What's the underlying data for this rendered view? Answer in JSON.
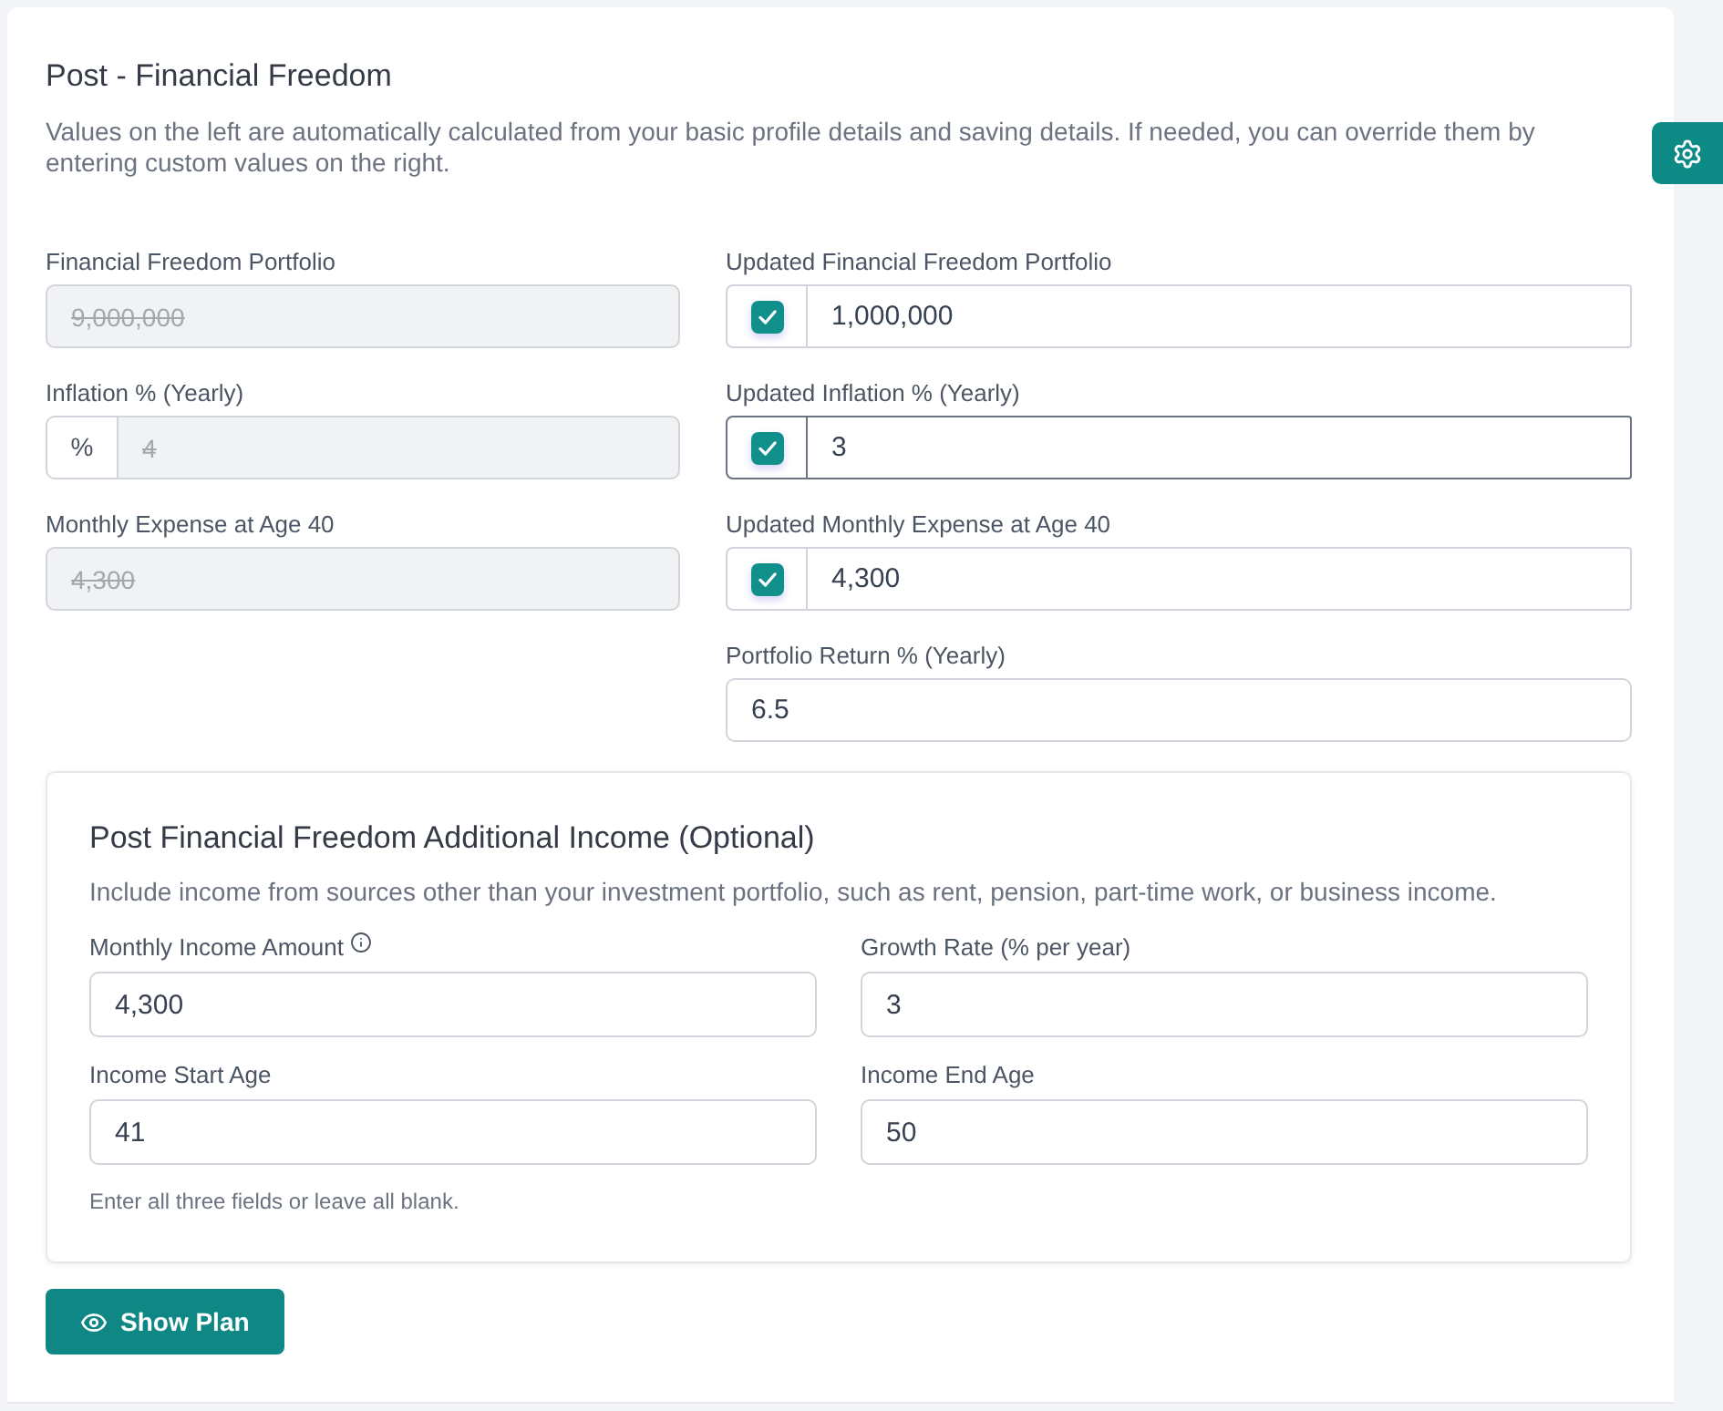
{
  "section": {
    "title": "Post - Financial Freedom",
    "description": "Values on the left are automatically calculated from your basic profile details and saving details. If needed, you can override them by entering custom values on the right."
  },
  "rows": [
    {
      "calculated": {
        "label": "Financial Freedom Portfolio",
        "value": "9,000,000",
        "disabled": true
      },
      "override": {
        "label": "Updated Financial Freedom Portfolio",
        "value": "1,000,000",
        "checked": true,
        "focused": false
      }
    },
    {
      "calculated": {
        "label": "Inflation % (Yearly)",
        "prefix": "%",
        "value": "4",
        "disabled": true
      },
      "override": {
        "label": "Updated Inflation % (Yearly)",
        "value": "3",
        "checked": true,
        "focused": true
      }
    },
    {
      "calculated": {
        "label": "Monthly Expense at Age 40",
        "value": "4,300",
        "disabled": true
      },
      "override": {
        "label": "Updated Monthly Expense at Age 40",
        "value": "4,300",
        "checked": true,
        "focused": false
      }
    }
  ],
  "portfolio_return": {
    "label": "Portfolio Return % (Yearly)",
    "value": "6.5"
  },
  "additional_income": {
    "title": "Post Financial Freedom Additional Income (Optional)",
    "description": "Include income from sources other than your investment portfolio, such as rent, pension, part-time work, or business income.",
    "fields": [
      {
        "label": "Monthly Income Amount",
        "info": true,
        "value": "4,300"
      },
      {
        "label": "Growth Rate (% per year)",
        "info": false,
        "value": "3"
      },
      {
        "label": "Income Start Age",
        "info": false,
        "value": "41"
      },
      {
        "label": "Income End Age",
        "info": false,
        "value": "50"
      }
    ],
    "note": "Enter all three fields or leave all blank."
  },
  "show_plan_button": {
    "label": "Show Plan"
  }
}
